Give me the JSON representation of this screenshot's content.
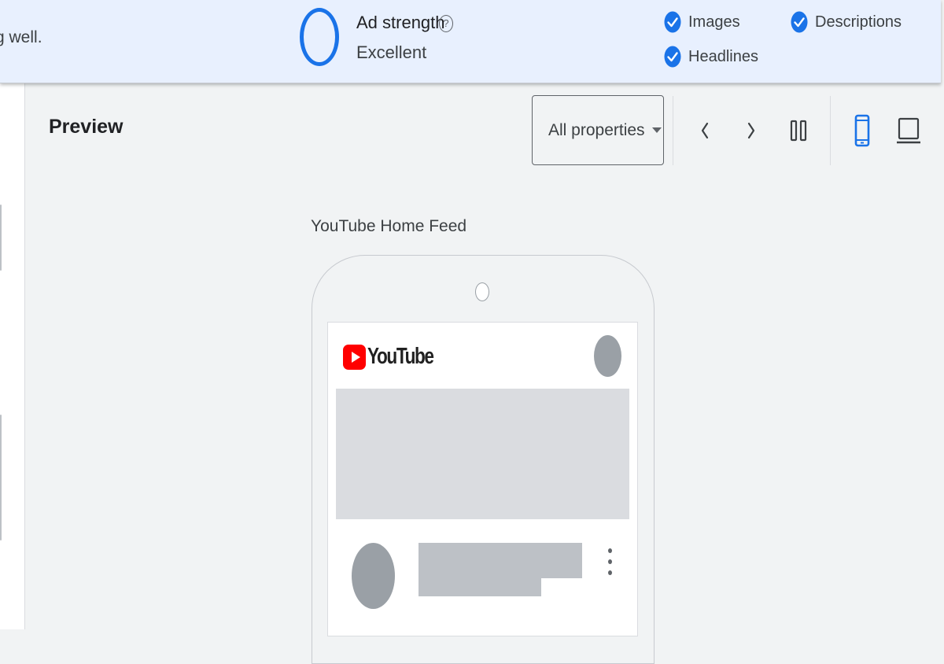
{
  "banner": {
    "message": "g well.",
    "ad_strength": {
      "label": "Ad strength",
      "help_icon": "help-circle-icon",
      "value": "Excellent",
      "color": "#1a73e8"
    },
    "checklist": [
      {
        "label": "Images",
        "checked": true,
        "icon": "check-circle-icon"
      },
      {
        "label": "Headlines",
        "checked": true,
        "icon": "check-circle-icon"
      },
      {
        "label": "Descriptions",
        "checked": true,
        "icon": "check-circle-icon"
      }
    ]
  },
  "preview": {
    "title": "Preview",
    "properties_select": {
      "selected": "All properties",
      "icon": "dropdown-caret-icon"
    },
    "toolbar": {
      "previous_icon": "chevron-left-icon",
      "next_icon": "chevron-right-icon",
      "pause_icon": "pause-icon",
      "mobile_view_icon": "smartphone-icon",
      "desktop_view_icon": "laptop-icon",
      "active_view": "mobile",
      "active_color": "#1a73e8"
    },
    "placement_label": "YouTube Home Feed",
    "youtube_logo_text": "YouTube",
    "brand_color": "#ff0000"
  }
}
